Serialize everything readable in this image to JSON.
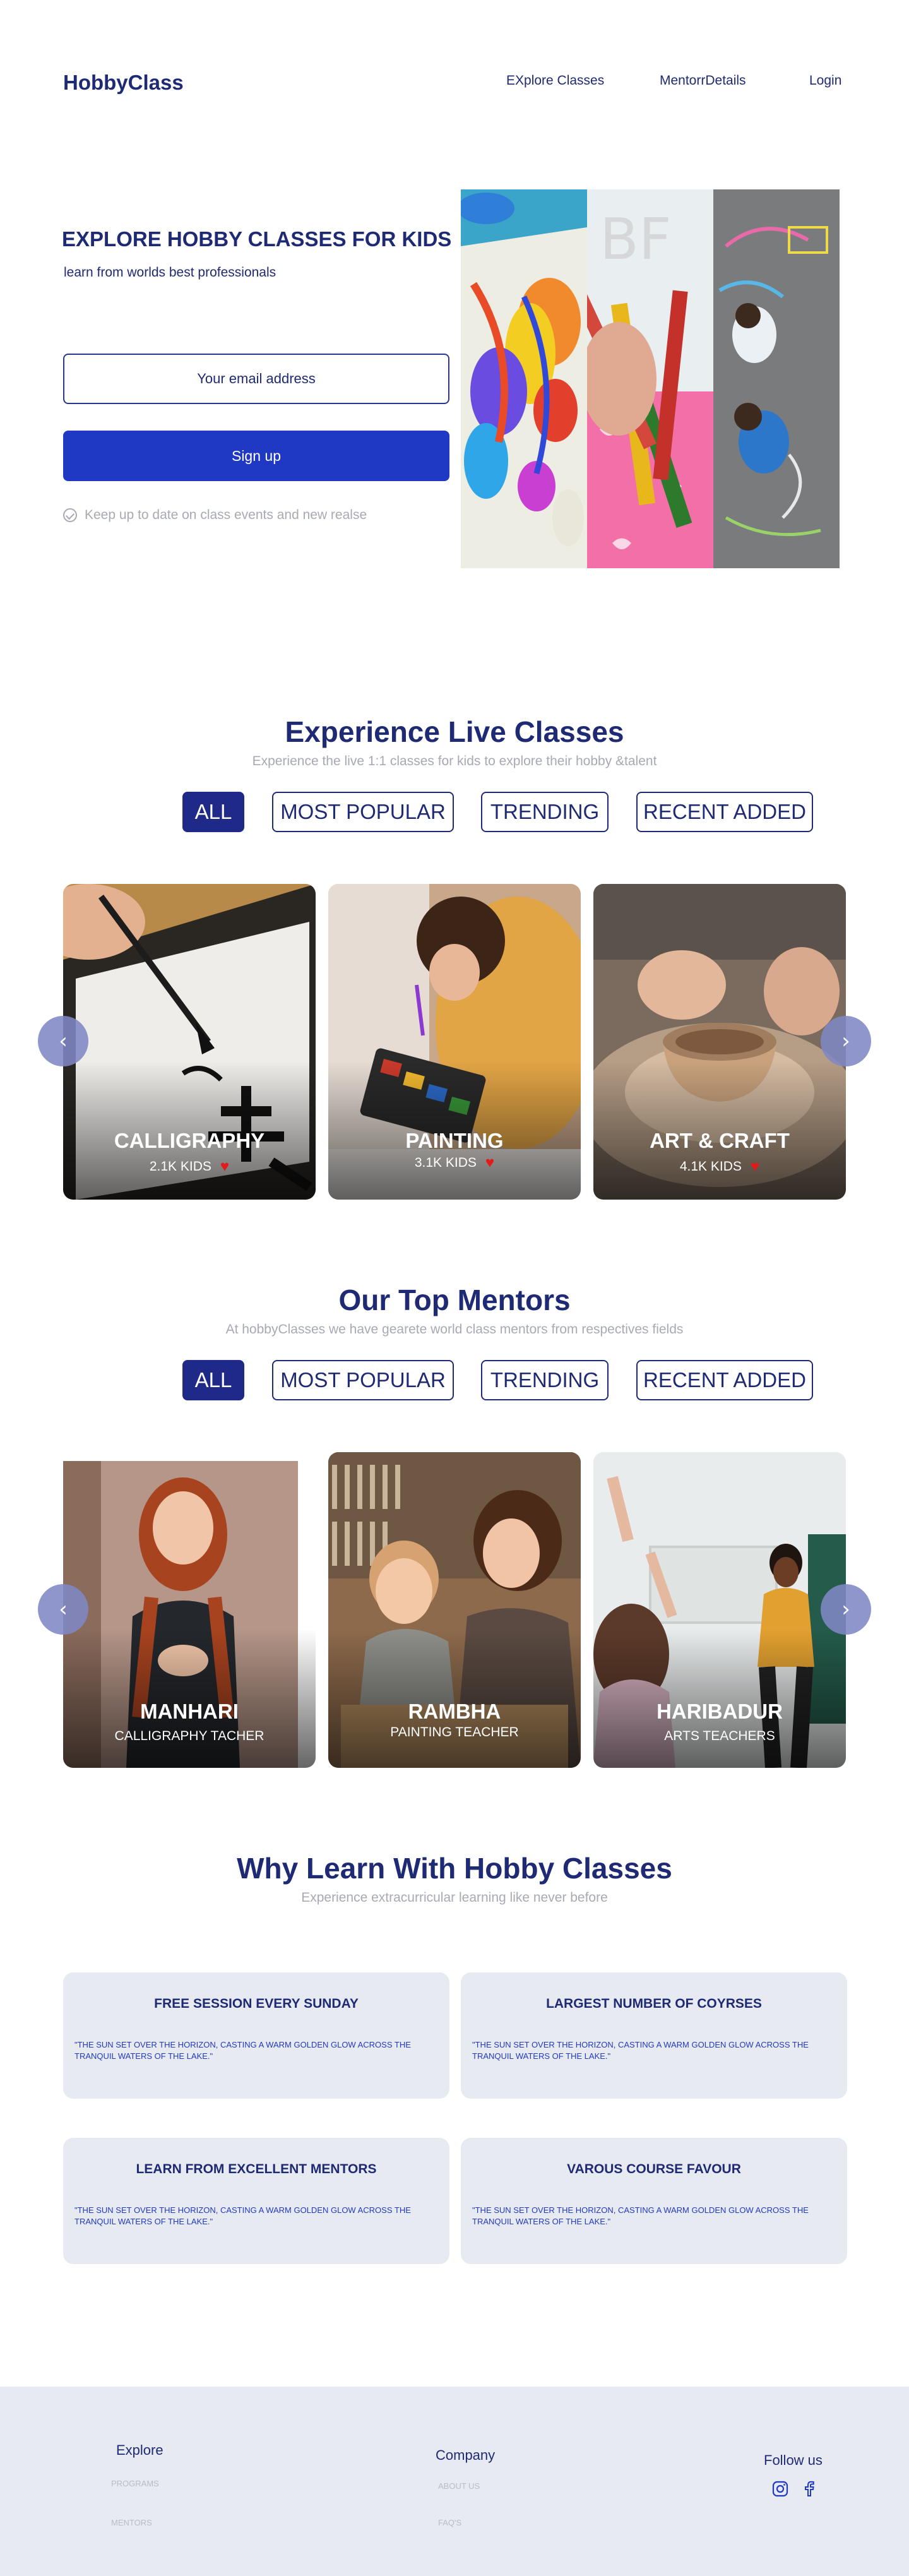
{
  "header": {
    "logo": "HobbyClass",
    "nav": [
      "EXplore Classes",
      "MentorrDetails",
      "Login"
    ]
  },
  "hero": {
    "title": "EXPLORE HOBBY CLASSES FOR KIDS",
    "subtitle": "learn from worlds best professionals",
    "email_placeholder": "Your email address",
    "signup_label": "Sign up",
    "note": "Keep  up to date on class events and new realse"
  },
  "classes": {
    "title": "Experience Live Classes",
    "subtitle": "Experience the live 1:1 classes for kids to explore their hobby &talent",
    "filters": [
      "ALL",
      "MOST POPULAR",
      "TRENDING",
      "RECENT ADDED"
    ],
    "active_filter": "ALL",
    "cards": [
      {
        "name": "CALLIGRAPHY",
        "kids": "2.1K KIDS"
      },
      {
        "name": "PAINTING",
        "kids": "3.1K KIDS"
      },
      {
        "name": "ART & CRAFT",
        "kids": "4.1K KIDS"
      }
    ]
  },
  "mentors": {
    "title": "Our  Top  Mentors",
    "subtitle": "At  hobbyClasses we have gearete world class mentors from respectives fields",
    "filters": [
      "ALL",
      "MOST POPULAR",
      "TRENDING",
      "RECENT ADDED"
    ],
    "active_filter": "ALL",
    "cards": [
      {
        "name": "MANHARI",
        "role": "CALLIGRAPHY TACHER"
      },
      {
        "name": "RAMBHA",
        "role": "PAINTING TEACHER"
      },
      {
        "name": "HARIBADUR",
        "role": "ARTS TEACHERS"
      }
    ]
  },
  "why": {
    "title": "Why Learn With Hobby Classes",
    "subtitle": "Experience extracurricular learning like never before",
    "features": [
      {
        "title": "FREE SESSION EVERY SUNDAY",
        "text": "\"THE SUN SET OVER THE HORIZON, CASTING A WARM GOLDEN GLOW ACROSS THE TRANQUIL WATERS OF THE LAKE.\""
      },
      {
        "title": "LARGEST NUMBER OF COYRSES",
        "text": "\"THE SUN SET OVER THE HORIZON, CASTING A WARM GOLDEN GLOW ACROSS THE TRANQUIL WATERS OF THE LAKE.\""
      },
      {
        "title": "LEARN FROM EXCELLENT MENTORS",
        "text": "\"THE SUN SET OVER THE HORIZON, CASTING A WARM GOLDEN GLOW ACROSS THE TRANQUIL WATERS OF THE LAKE.\""
      },
      {
        "title": "VAROUS COURSE FAVOUR",
        "text": "\"THE SUN SET OVER THE HORIZON, CASTING A WARM GOLDEN GLOW ACROSS THE TRANQUIL WATERS OF THE LAKE.\""
      }
    ]
  },
  "footer": {
    "explore": {
      "heading": "Explore",
      "links": [
        "PROGRAMS",
        "MENTORS"
      ]
    },
    "company": {
      "heading": "Company",
      "links": [
        "ABOUT  US",
        "FAQ'S"
      ]
    },
    "follow": {
      "heading": "Follow us",
      "icons": [
        "instagram-icon",
        "facebook-icon"
      ]
    }
  },
  "colors": {
    "primary": "#1f2a74",
    "button": "#2039c4",
    "muted": "#a7a9b5",
    "panel": "#e8eaf1",
    "heart": "#e3191a"
  }
}
